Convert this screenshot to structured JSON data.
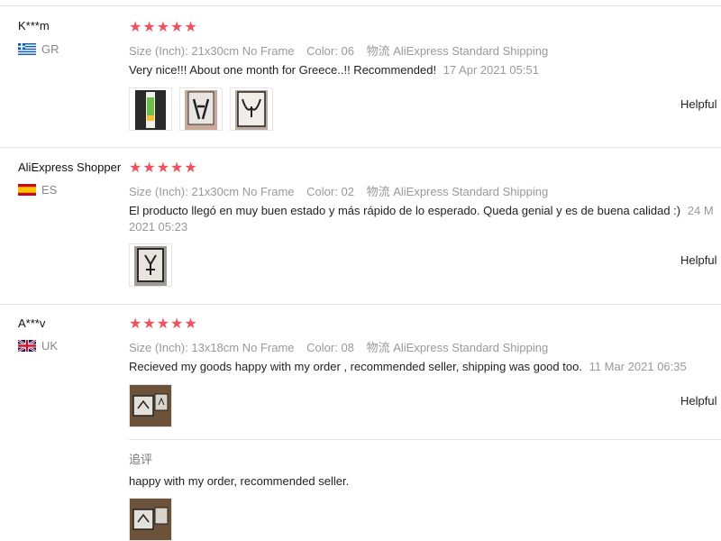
{
  "reviews": [
    {
      "user": "K***m",
      "country_code": "GR",
      "stars": "★★★★★",
      "size_label": "Size (Inch):",
      "size_value": "21x30cm No Frame",
      "color_label": "Color:",
      "color_value": "06",
      "ship_label": "物流",
      "ship_value": "AliExpress Standard Shipping",
      "text": "Very nice!!! About one month for Greece..!! Recommended!",
      "date": "17 Apr 2021 05:51",
      "helpful": "Helpful"
    },
    {
      "user": "AliExpress Shopper",
      "country_code": "ES",
      "stars": "★★★★★",
      "size_label": "Size (Inch):",
      "size_value": "21x30cm No Frame",
      "color_label": "Color:",
      "color_value": "02",
      "ship_label": "物流",
      "ship_value": "AliExpress Standard Shipping",
      "text": "El producto llegó en muy buen estado y más rápido de lo esperado. Queda genial y es de buena calidad :)",
      "date_part1": "24 M",
      "date_part2": "2021 05:23",
      "helpful": "Helpful"
    },
    {
      "user": "A***v",
      "country_code": "UK",
      "stars": "★★★★★",
      "size_label": "Size (Inch):",
      "size_value": "13x18cm No Frame",
      "color_label": "Color:",
      "color_value": "08",
      "ship_label": "物流",
      "ship_value": "AliExpress Standard Shipping",
      "text": "Recieved my goods happy with my order , recommended seller, shipping was good too.",
      "date": "11 Mar 2021 06:35",
      "helpful": "Helpful",
      "followup_label": "追评",
      "followup_text": "happy with my order, recommended seller."
    }
  ],
  "colors": {
    "star": "#f0515b",
    "muted": "#999999",
    "border": "#e6e6e6"
  }
}
